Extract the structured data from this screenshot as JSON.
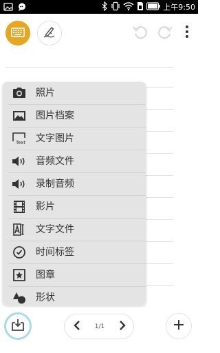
{
  "status_bar": {
    "time": "上午9:50",
    "icons": [
      "gallery-icon",
      "chat-icon",
      "bluetooth-icon",
      "vibrate-icon",
      "wifi-icon",
      "sim-icon",
      "battery-icon"
    ]
  },
  "toolbar": {
    "keyboard_icon": "keyboard-icon",
    "pen_icon": "pen-icon",
    "undo_icon": "undo-icon",
    "redo_icon": "redo-icon",
    "more_icon": "more-vertical-icon",
    "accent_color": "#e8a51f"
  },
  "insert_menu": {
    "items": [
      {
        "label": "照片",
        "icon": "camera-icon"
      },
      {
        "label": "图片档案",
        "icon": "image-icon"
      },
      {
        "label": "文字图片",
        "icon": "text-image-icon"
      },
      {
        "label": "音频文件",
        "icon": "speaker-icon"
      },
      {
        "label": "录制音频",
        "icon": "speaker-record-icon"
      },
      {
        "label": "影片",
        "icon": "film-icon"
      },
      {
        "label": "文字文件",
        "icon": "text-file-icon"
      },
      {
        "label": "时间标签",
        "icon": "clock-icon"
      },
      {
        "label": "图章",
        "icon": "stamp-icon"
      },
      {
        "label": "形状",
        "icon": "shapes-icon"
      }
    ],
    "text_image_badge": "Text"
  },
  "bottom_bar": {
    "insert_icon": "insert-icon",
    "page_indicator": "1/1",
    "prev_icon": "chevron-left-icon",
    "next_icon": "chevron-right-icon",
    "add_icon": "plus-icon",
    "insert_ring_color": "#a9d9ea"
  }
}
